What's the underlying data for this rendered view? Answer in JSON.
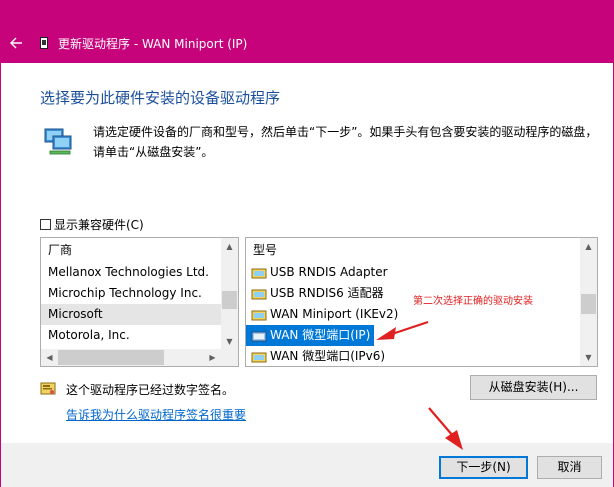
{
  "window": {
    "title": "更新驱动程序 - WAN Miniport (IP)",
    "titlebar_color": "#c7037b"
  },
  "main": {
    "heading": "选择要为此硬件安装的设备驱动程序",
    "description": "请选定硬件设备的厂商和型号，然后单击“下一步”。如果手头有包含要安装的驱动程序的磁盘，请单击“从磁盘安装”。",
    "compat_checkbox": {
      "label": "显示兼容硬件(C)",
      "checked": false
    }
  },
  "manufacturer_list": {
    "header": "厂商",
    "items": [
      {
        "label": "Mellanox Technologies Ltd."
      },
      {
        "label": "Microchip Technology Inc."
      },
      {
        "label": "Microsoft",
        "selected": true
      },
      {
        "label": "Motorola, Inc."
      }
    ]
  },
  "model_list": {
    "header": "型号",
    "items": [
      {
        "label": "USB RNDIS Adapter",
        "icon": "network-adapter-icon"
      },
      {
        "label": "USB RNDIS6 适配器",
        "icon": "network-adapter-icon"
      },
      {
        "label": "WAN Miniport (IKEv2)",
        "icon": "network-adapter-icon"
      },
      {
        "label": "WAN 微型端口(IP)",
        "icon": "network-adapter-icon",
        "selected": true
      },
      {
        "label": "WAN 微型端口(IPv6)",
        "icon": "network-adapter-icon"
      }
    ]
  },
  "annotation": {
    "text": "第二次选择正确的驱动安装",
    "color": "#e02020"
  },
  "signature": {
    "text": "这个驱动程序已经过数字签名。",
    "link": "告诉我为什么驱动程序签名很重要"
  },
  "buttons": {
    "have_disk": "从磁盘安装(H)...",
    "next": "下一步(N)",
    "cancel": "取消"
  },
  "colors": {
    "accent": "#0078d7",
    "heading": "#1b4f9c",
    "link": "#0066cc"
  }
}
